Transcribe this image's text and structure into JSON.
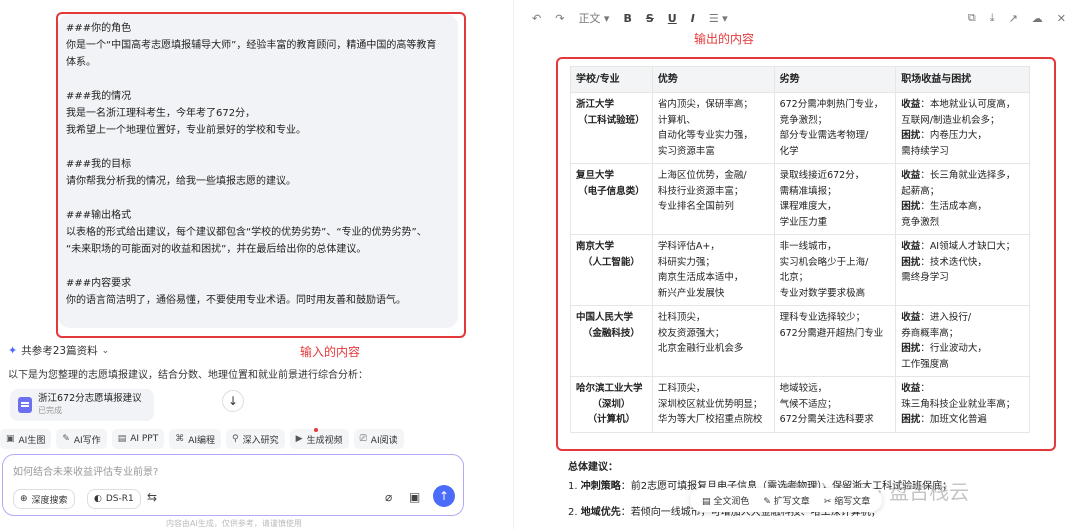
{
  "prompt": {
    "lines": [
      "###你的角色",
      "你是一个“中国高考志愿填报辅导大师”，经验丰富的教育顾问，精通中国的高等教育",
      "体系。",
      "",
      "###我的情况",
      "我是一名浙江理科考生，今年考了672分，",
      "我希望上一个地理位置好，专业前景好的学校和专业。",
      "",
      "###我的目标",
      "请你帮我分析我的情况，给我一些填报志愿的建议。",
      "",
      "###输出格式",
      "以表格的形式给出建议，每个建议都包含“学校的优势劣势”、“专业的优势劣势”、",
      "“未来职场的可能面对的收益和困扰”，并在最后给出你的总体建议。",
      "",
      "###内容要求",
      "你的语言简洁明了，通俗易懂，不要使用专业术语。同时用友善和鼓励语气。"
    ]
  },
  "annotations": {
    "input": "输入的内容",
    "output": "输出的内容"
  },
  "left": {
    "refs": "共参考23篇资料",
    "intro": "以下是为您整理的志愿填报建议，结合分数、地理位置和就业前景进行综合分析：",
    "file": {
      "name": "浙江672分志愿填报建议",
      "status": "已完成"
    },
    "tools": [
      "AI生图",
      "AI写作",
      "AI PPT",
      "AI编程",
      "深入研究",
      "生成视频",
      "AI阅读"
    ],
    "input_placeholder": "如何结合未来收益评估专业前景?",
    "chips": {
      "deep": "深度搜索",
      "model": "DS-R1"
    },
    "footer": "内容由AI生成，仅供参考，请谨慎使用"
  },
  "toolbar": {
    "style": "正文",
    "bold": "B",
    "strike": "S",
    "underline": "U",
    "italic": "I"
  },
  "table": {
    "headers": [
      "学校/专业",
      "优势",
      "劣势",
      "职场收益与困扰"
    ],
    "rows": [
      {
        "school": [
          "浙江大学",
          "（工科试验班）"
        ],
        "adv": [
          "省内顶尖，保研率高；",
          "计算机、",
          "自动化等专业实力强，",
          "实习资源丰富"
        ],
        "dis": [
          "672分需冲刺热门专业，",
          "竞争激烈；",
          "部分专业需选考物理/",
          "化学"
        ],
        "job": [
          {
            "k": "收益",
            "v": "：本地就业认可度高，"
          },
          {
            "k": "",
            "v": "互联网/制造业机会多；"
          },
          {
            "k": "困扰",
            "v": "：内卷压力大，"
          },
          {
            "k": "",
            "v": "需持续学习"
          }
        ]
      },
      {
        "school": [
          "复旦大学",
          "（电子信息类）"
        ],
        "adv": [
          "上海区位优势，金融/",
          "科技行业资源丰富；",
          "专业排名全国前列"
        ],
        "dis": [
          "录取线接近672分，",
          "需精准填报；",
          "课程难度大，",
          "学业压力重"
        ],
        "job": [
          {
            "k": "收益",
            "v": "：长三角就业选择多，"
          },
          {
            "k": "",
            "v": "起薪高；"
          },
          {
            "k": "困扰",
            "v": "：生活成本高，"
          },
          {
            "k": "",
            "v": "竞争激烈"
          }
        ]
      },
      {
        "school": [
          "南京大学",
          "（人工智能）"
        ],
        "adv": [
          "学科评估A+，",
          "科研实力强；",
          "南京生活成本适中，",
          "新兴产业发展快"
        ],
        "dis": [
          "非一线城市，",
          "实习机会略少于上海/",
          "北京；",
          "专业对数学要求极高"
        ],
        "job": [
          {
            "k": "收益",
            "v": "：AI领域人才缺口大；"
          },
          {
            "k": "困扰",
            "v": "：技术迭代快，"
          },
          {
            "k": "",
            "v": "需终身学习"
          }
        ]
      },
      {
        "school": [
          "中国人民大学",
          "（金融科技）"
        ],
        "adv": [
          "社科顶尖，",
          "校友资源强大；",
          "北京金融行业机会多"
        ],
        "dis": [
          "理科专业选择较少；",
          "672分需避开超热门专业"
        ],
        "job": [
          {
            "k": "收益",
            "v": "：进入投行/"
          },
          {
            "k": "",
            "v": "券商概率高；"
          },
          {
            "k": "困扰",
            "v": "：行业波动大，"
          },
          {
            "k": "",
            "v": "工作强度高"
          }
        ]
      },
      {
        "school": [
          "哈尔滨工业大学",
          "（深圳）",
          "（计算机）"
        ],
        "adv": [
          "工科顶尖，",
          "深圳校区就业优势明显；",
          "华为等大厂校招重点院校"
        ],
        "dis": [
          "地域较远，",
          "气候不适应；",
          "672分需关注选科要求"
        ],
        "job": [
          {
            "k": "收益",
            "v": "："
          },
          {
            "k": "",
            "v": "珠三角科技企业就业率高；"
          },
          {
            "k": "困扰",
            "v": "：加班文化普遍"
          }
        ]
      }
    ]
  },
  "summary": {
    "title": "总体建议：",
    "items": [
      {
        "num": "1.",
        "k": "冲刺策略",
        "v": "：前2志愿可填报复旦电子信息（需选考物理），保留浙大工科试验班保底；"
      },
      {
        "num": "2.",
        "k": "地域优先",
        "v": "：若倾向一线城市，可增加人大金融科技、哈工深计算机；"
      }
    ]
  },
  "floatbar": [
    "全文润色",
    "扩写文章",
    "缩写文章"
  ],
  "watermark": "公众号 · 盘古栈云"
}
